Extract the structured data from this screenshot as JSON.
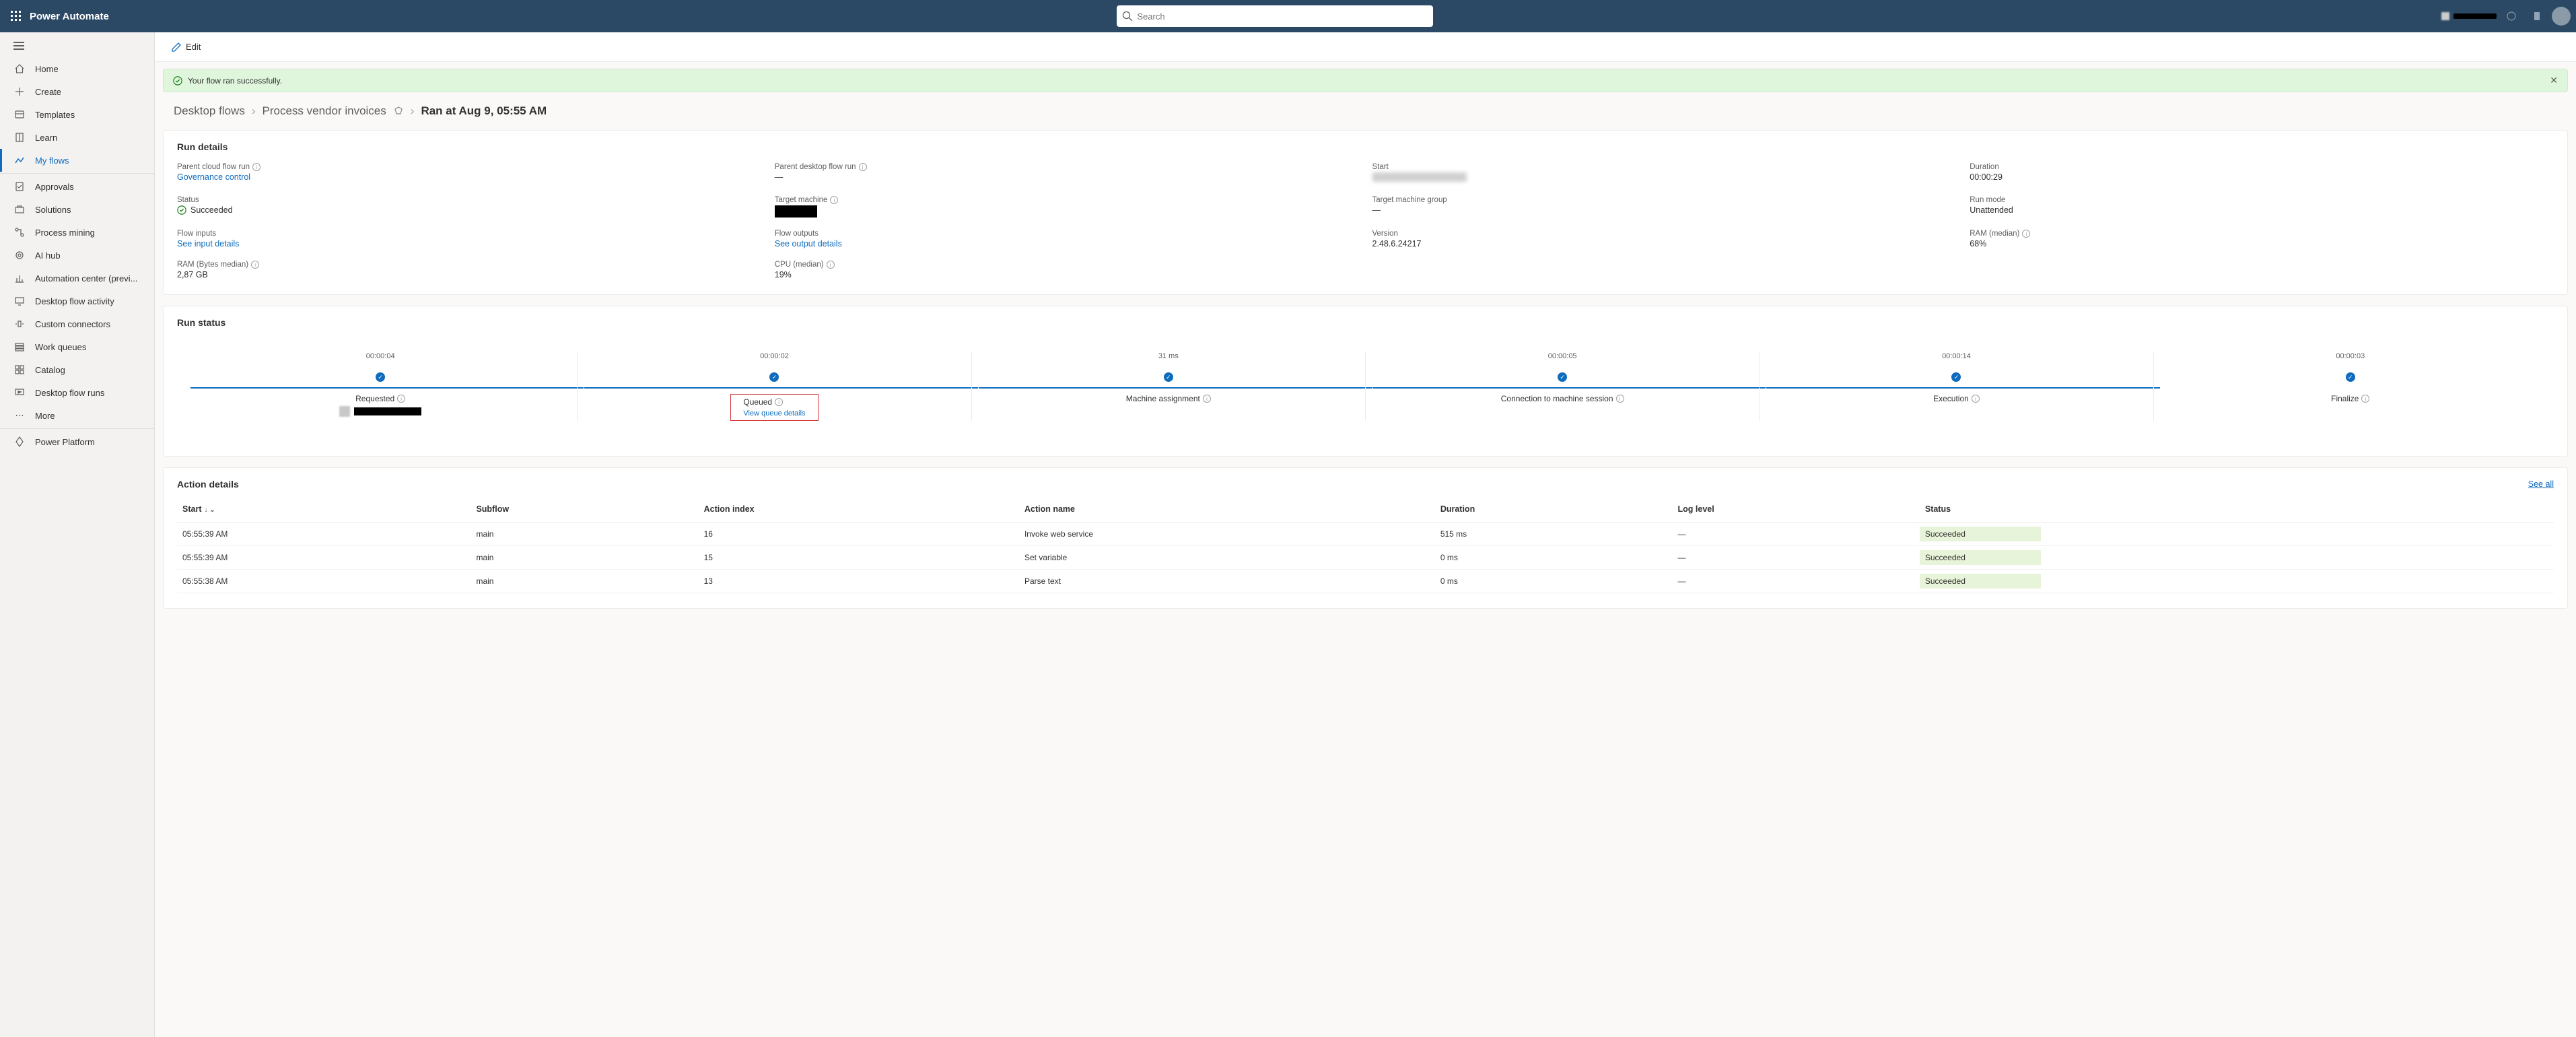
{
  "header": {
    "app_title": "Power Automate",
    "search_placeholder": "Search"
  },
  "sidebar": {
    "items": [
      {
        "label": "Home"
      },
      {
        "label": "Create"
      },
      {
        "label": "Templates"
      },
      {
        "label": "Learn"
      },
      {
        "label": "My flows"
      },
      {
        "label": "Approvals"
      },
      {
        "label": "Solutions"
      },
      {
        "label": "Process mining"
      },
      {
        "label": "AI hub"
      },
      {
        "label": "Automation center (previ..."
      },
      {
        "label": "Desktop flow activity"
      },
      {
        "label": "Custom connectors"
      },
      {
        "label": "Work queues"
      },
      {
        "label": "Catalog"
      },
      {
        "label": "Desktop flow runs"
      },
      {
        "label": "More"
      },
      {
        "label": "Power Platform"
      }
    ]
  },
  "commandbar": {
    "edit": "Edit"
  },
  "banner": {
    "text": "Your flow ran successfully."
  },
  "breadcrumb": {
    "root": "Desktop flows",
    "flow": "Process vendor invoices",
    "run": "Ran at Aug 9, 05:55 AM"
  },
  "run_details": {
    "title": "Run details",
    "fields": {
      "parent_cloud_label": "Parent cloud flow run",
      "parent_cloud_value": "Governance control",
      "parent_desktop_label": "Parent desktop flow run",
      "parent_desktop_value": "—",
      "start_label": "Start",
      "duration_label": "Duration",
      "duration_value": "00:00:29",
      "status_label": "Status",
      "status_value": "Succeeded",
      "target_machine_label": "Target machine",
      "target_group_label": "Target machine group",
      "target_group_value": "—",
      "run_mode_label": "Run mode",
      "run_mode_value": "Unattended",
      "flow_inputs_label": "Flow inputs",
      "flow_inputs_value": "See input details",
      "flow_outputs_label": "Flow outputs",
      "flow_outputs_value": "See output details",
      "version_label": "Version",
      "version_value": "2.48.6.24217",
      "ram_median_label": "RAM (median)",
      "ram_median_value": "68%",
      "ram_bytes_label": "RAM (Bytes median)",
      "ram_bytes_value": "2,87 GB",
      "cpu_label": "CPU (median)",
      "cpu_value": "19%"
    }
  },
  "run_status": {
    "title": "Run status",
    "steps": [
      {
        "dur": "00:00:04",
        "label": "Requested"
      },
      {
        "dur": "00:00:02",
        "label": "Queued",
        "sub": "View queue details"
      },
      {
        "dur": "31 ms",
        "label": "Machine assignment"
      },
      {
        "dur": "00:00:05",
        "label": "Connection to machine session"
      },
      {
        "dur": "00:00:14",
        "label": "Execution"
      },
      {
        "dur": "00:00:03",
        "label": "Finalize"
      }
    ]
  },
  "action_details": {
    "title": "Action details",
    "see_all": "See all",
    "columns": {
      "start": "Start",
      "subflow": "Subflow",
      "index": "Action index",
      "name": "Action name",
      "duration": "Duration",
      "log": "Log level",
      "status": "Status"
    },
    "rows": [
      {
        "start": "05:55:39 AM",
        "subflow": "main",
        "index": "16",
        "name": "Invoke web service",
        "duration": "515 ms",
        "log": "—",
        "status": "Succeeded"
      },
      {
        "start": "05:55:39 AM",
        "subflow": "main",
        "index": "15",
        "name": "Set variable",
        "duration": "0 ms",
        "log": "—",
        "status": "Succeeded"
      },
      {
        "start": "05:55:38 AM",
        "subflow": "main",
        "index": "13",
        "name": "Parse text",
        "duration": "0 ms",
        "log": "—",
        "status": "Succeeded"
      }
    ]
  }
}
